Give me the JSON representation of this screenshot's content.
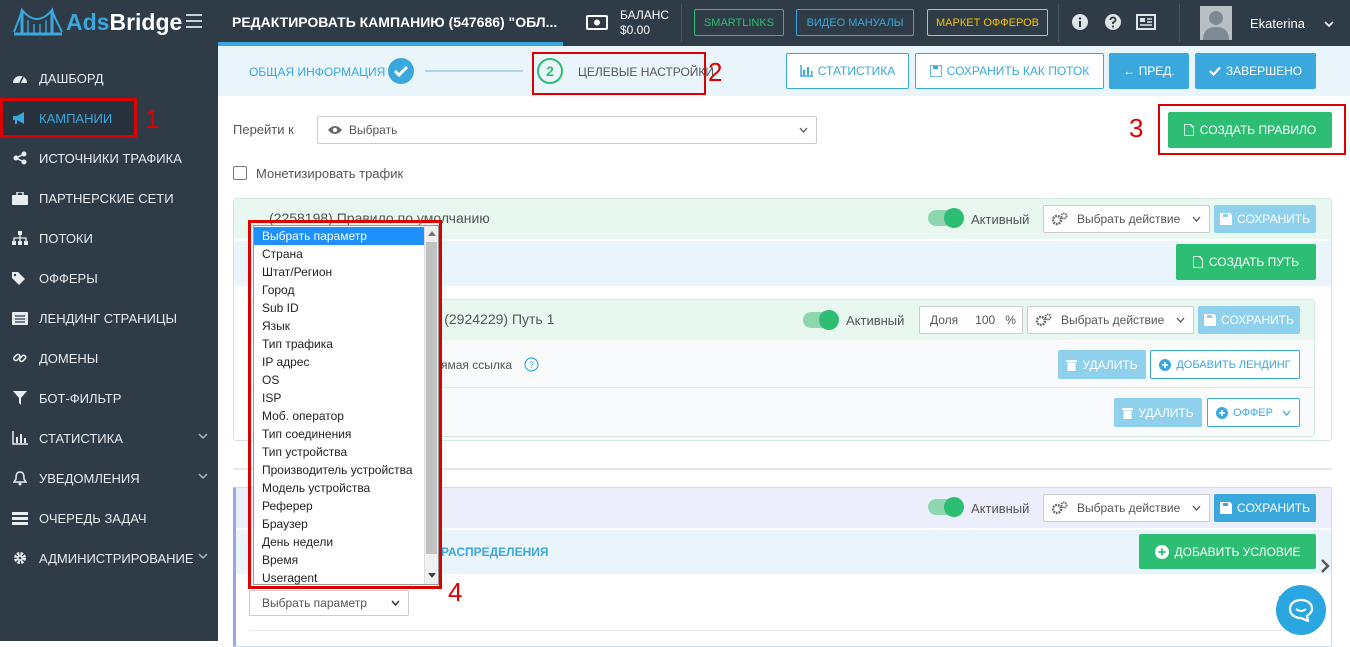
{
  "app": {
    "brand_a": "Ads",
    "brand_b": "Bridge"
  },
  "sidebar": {
    "items": [
      {
        "label": "ДАШБОРД",
        "icon": "dashboard-icon"
      },
      {
        "label": "КАМПАНИИ",
        "icon": "megaphone-icon"
      },
      {
        "label": "ИСТОЧНИКИ ТРАФИКА",
        "icon": "share-icon"
      },
      {
        "label": "ПАРТНЕРСКИЕ СЕТИ",
        "icon": "briefcase-icon"
      },
      {
        "label": "ПОТОКИ",
        "icon": "sitemap-icon"
      },
      {
        "label": "ОФФЕРЫ",
        "icon": "tags-icon"
      },
      {
        "label": "ЛЕНДИНГ СТРАНИЦЫ",
        "icon": "list-icon"
      },
      {
        "label": "ДОМЕНЫ",
        "icon": "link-icon"
      },
      {
        "label": "БОТ-ФИЛЬТР",
        "icon": "filter-icon"
      },
      {
        "label": "СТАТИСТИКА",
        "icon": "bar-chart-icon"
      },
      {
        "label": "УВЕДОМЛЕНИЯ",
        "icon": "bell-icon"
      },
      {
        "label": "ОЧЕРЕДЬ ЗАДАЧ",
        "icon": "tasks-icon"
      },
      {
        "label": "АДМИНИСТРИРОВАНИЕ",
        "icon": "gear-icon"
      }
    ]
  },
  "topbar": {
    "title": "РЕДАКТИРОВАТЬ КАМПАНИЮ (547686) \"ОБЛ...",
    "balance_label": "БАЛАНС",
    "balance_value": "$0.00",
    "smartlinks": "SMARTLINKS",
    "video": "ВИДЕО МАНУАЛЫ",
    "market": "МАРКЕТ ОФФЕРОВ",
    "username": "Ekaterina"
  },
  "steps": {
    "step1": "ОБЩАЯ ИНФОРМАЦИЯ",
    "step2_num": "2",
    "step2": "ЦЕЛЕВЫЕ НАСТРОЙКИ",
    "stats": "СТАТИСТИКА",
    "save_flow": "СОХРАНИТЬ КАК ПОТОК",
    "prev": "← ПРЕД.",
    "done": "ЗАВЕРШЕНО"
  },
  "annotations": {
    "a1": "1",
    "a2": "2",
    "a3": "3",
    "a4": "4"
  },
  "main": {
    "goto_label": "Перейти к",
    "goto_value": "Выбрать",
    "create_rule": "СОЗДАТЬ ПРАВИЛО",
    "monetize": "Монетизировать трафик",
    "rule1_title": "(2258198) Правило по умолчанию",
    "active": "Активный",
    "choose_action": "Выбрать действие",
    "save": "СОХРАНИТЬ",
    "create_path": "СОЗДАТЬ ПУТЬ",
    "path_title": "о - (2924229) Путь 1",
    "share_label": "Доля",
    "share_value": "100",
    "share_unit": "%",
    "link_text": "ямая ссылка",
    "delete": "УДАЛИТЬ",
    "add_landing": "ДОБАВИТЬ ЛЕНДИНГ",
    "offer": "ОФФЕР",
    "distribution": "РАСПРЕДЕЛЕНИЯ",
    "add_condition": "ДОБАВИТЬ УСЛОВИЕ",
    "param_select": "Выбрать параметр"
  },
  "dropdown": {
    "options": [
      "Выбрать параметр",
      "Страна",
      "Штат/Регион",
      "Город",
      "Sub ID",
      "Язык",
      "Тип трафика",
      "IP адрес",
      "OS",
      "ISP",
      "Моб. оператор",
      "Тип соединения",
      "Тип устройства",
      "Производитель устройства",
      "Модель устройства",
      "Реферер",
      "Браузер",
      "День недели",
      "Время",
      "Useragent"
    ]
  },
  "colors": {
    "accent": "#3aa8dc",
    "green": "#2dbd73",
    "sidebar": "#2f3b46",
    "annotation": "#d00000"
  }
}
